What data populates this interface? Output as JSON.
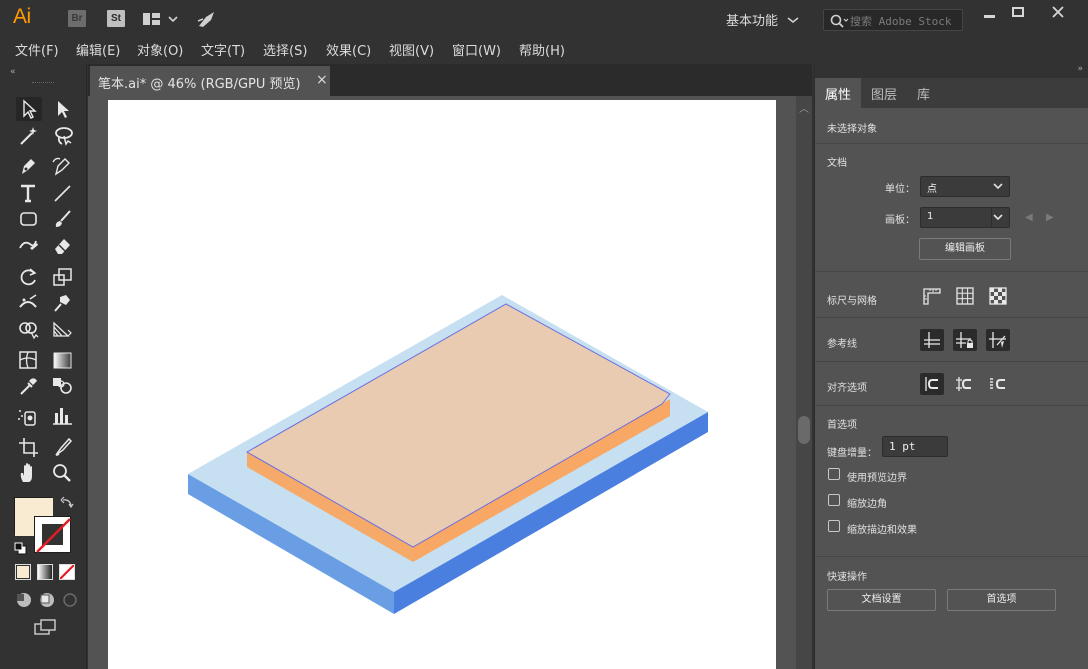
{
  "app": {
    "logo": "Ai",
    "bridge_badge": "Br",
    "stock_badge": "St",
    "workspace": "基本功能"
  },
  "search": {
    "placeholder": "搜索 Adobe Stock"
  },
  "menu": [
    "文件(F)",
    "编辑(E)",
    "对象(O)",
    "文字(T)",
    "选择(S)",
    "效果(C)",
    "视图(V)",
    "窗口(W)",
    "帮助(H)"
  ],
  "tools": [
    "selection-tool",
    "direct-selection-tool",
    "magic-wand-tool",
    "lasso-tool",
    "pen-tool",
    "curvature-tool",
    "type-tool",
    "line-segment-tool",
    "rectangle-tool",
    "paintbrush-tool",
    "shaper-tool",
    "eraser-tool",
    "rotate-tool",
    "scale-tool",
    "width-tool",
    "puppet-warp-tool",
    "shape-builder-tool",
    "perspective-grid-tool",
    "mesh-tool",
    "gradient-tool",
    "eyedropper-tool",
    "blend-tool",
    "symbol-sprayer-tool",
    "column-graph-tool",
    "artboard-tool",
    "slice-tool",
    "hand-tool",
    "zoom-tool"
  ],
  "colors": {
    "fill": "#f8ebd2",
    "stroke": "none",
    "accent_orange": "#ff9a00"
  },
  "document": {
    "tab_label": "笔本.ai* @ 46% (RGB/GPU 预览)",
    "close": "×"
  },
  "artwork": {
    "base_top": "#c6e0f2",
    "base_left": "#6a9ee4",
    "base_right": "#4a7fe0",
    "slab_top": "#e8cbb1",
    "slab_front": "#f6aa6a",
    "slab_right": "#f9a764",
    "outline": "#6b6fe0"
  },
  "panel": {
    "tabs": [
      "属性",
      "图层",
      "库"
    ],
    "no_selection": "未选择对象",
    "document_section": "文档",
    "unit_label": "单位：",
    "unit_value": "点",
    "artboard_label": "画板：",
    "artboard_value": "1",
    "edit_artboards": "编辑画板",
    "rulers_grids": "标尺与网格",
    "guides": "参考线",
    "snap_options": "对齐选项",
    "preferences": "首选项",
    "keyboard_increment_label": "键盘增量：",
    "keyboard_increment_value": "1 pt",
    "use_preview_bounds": "使用预览边界",
    "scale_corners": "缩放边角",
    "scale_strokes_effects": "缩放描边和效果",
    "quick_actions": "快速操作",
    "document_setup": "文档设置",
    "preferences_button": "首选项"
  }
}
